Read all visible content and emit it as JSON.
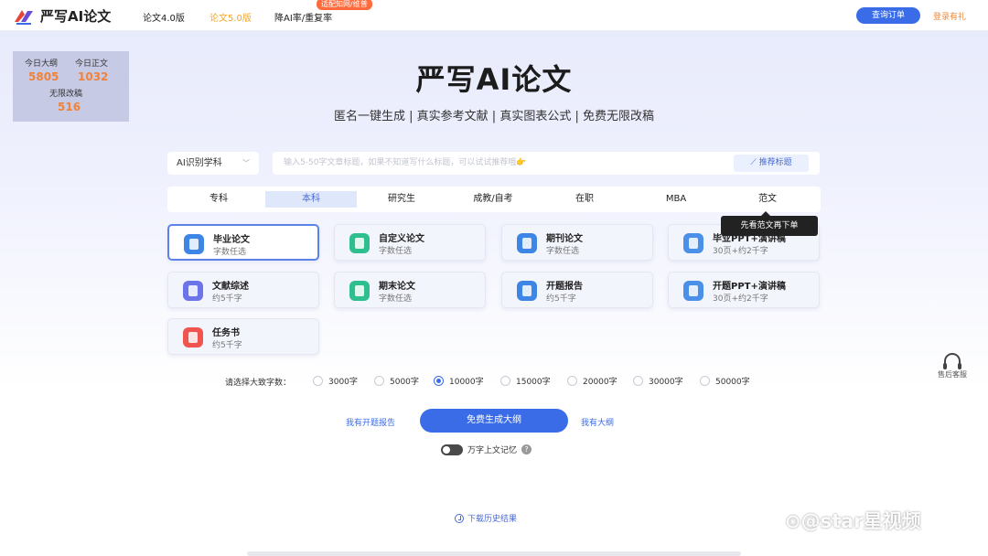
{
  "header": {
    "logo_text": "严写AI论文",
    "nav": [
      "论文4.0版",
      "论文5.0版",
      "降AI率/重复率"
    ],
    "nav_badge": "适配知网/维普",
    "query_button": "查询订单",
    "login_link": "登录有礼"
  },
  "stats": {
    "outline_label": "今日大纲",
    "outline_count": "5805",
    "body_label": "今日正文",
    "body_count": "1032",
    "revise_label": "无限改稿",
    "revise_count": "516"
  },
  "hero": {
    "title": "严写AI论文",
    "subtitle": "匿名一键生成 | 真实参考文献 | 真实图表公式 | 免费无限改稿"
  },
  "search": {
    "subject_select": "AI识别学科",
    "topic_placeholder": "输入5-50字文章标题，如果不知道写什么标题，可以试试推荐哦👉",
    "recommend_button": "推荐标题"
  },
  "levels": [
    "专科",
    "本科",
    "研究生",
    "成教/自考",
    "在职",
    "MBA",
    "范文"
  ],
  "tooltip": "先看范文再下单",
  "cards": [
    {
      "title": "毕业论文",
      "desc": "字数任选"
    },
    {
      "title": "自定义论文",
      "desc": "字数任选"
    },
    {
      "title": "期刊论文",
      "desc": "字数任选"
    },
    {
      "title": "毕业PPT+演讲稿",
      "desc": "30页+约2千字"
    },
    {
      "title": "文献综述",
      "desc": "约5千字"
    },
    {
      "title": "期末论文",
      "desc": "字数任选"
    },
    {
      "title": "开题报告",
      "desc": "约5千字"
    },
    {
      "title": "开题PPT+演讲稿",
      "desc": "30页+约2千字"
    },
    {
      "title": "任务书",
      "desc": "约5千字"
    }
  ],
  "card_colors": [
    "#3d86e6",
    "#2fbf8f",
    "#3d86e6",
    "#4a8fe8",
    "#6b74e8",
    "#2fbf8f",
    "#3d86e6",
    "#4a8fe8",
    "#f0544f"
  ],
  "word_count": {
    "label": "请选择大致字数：",
    "options": [
      "3000字",
      "5000字",
      "10000字",
      "15000字",
      "20000字",
      "30000字",
      "50000字"
    ],
    "selected": "10000字"
  },
  "actions": {
    "left_link": "我有开题报告",
    "generate_button": "免费生成大纲",
    "right_link": "我有大纲"
  },
  "memory_toggle": "万字上文记忆",
  "help_icon": "?",
  "download_link": "下载历史结果",
  "support": "售后客服",
  "watermark": "⊙@star星视频"
}
